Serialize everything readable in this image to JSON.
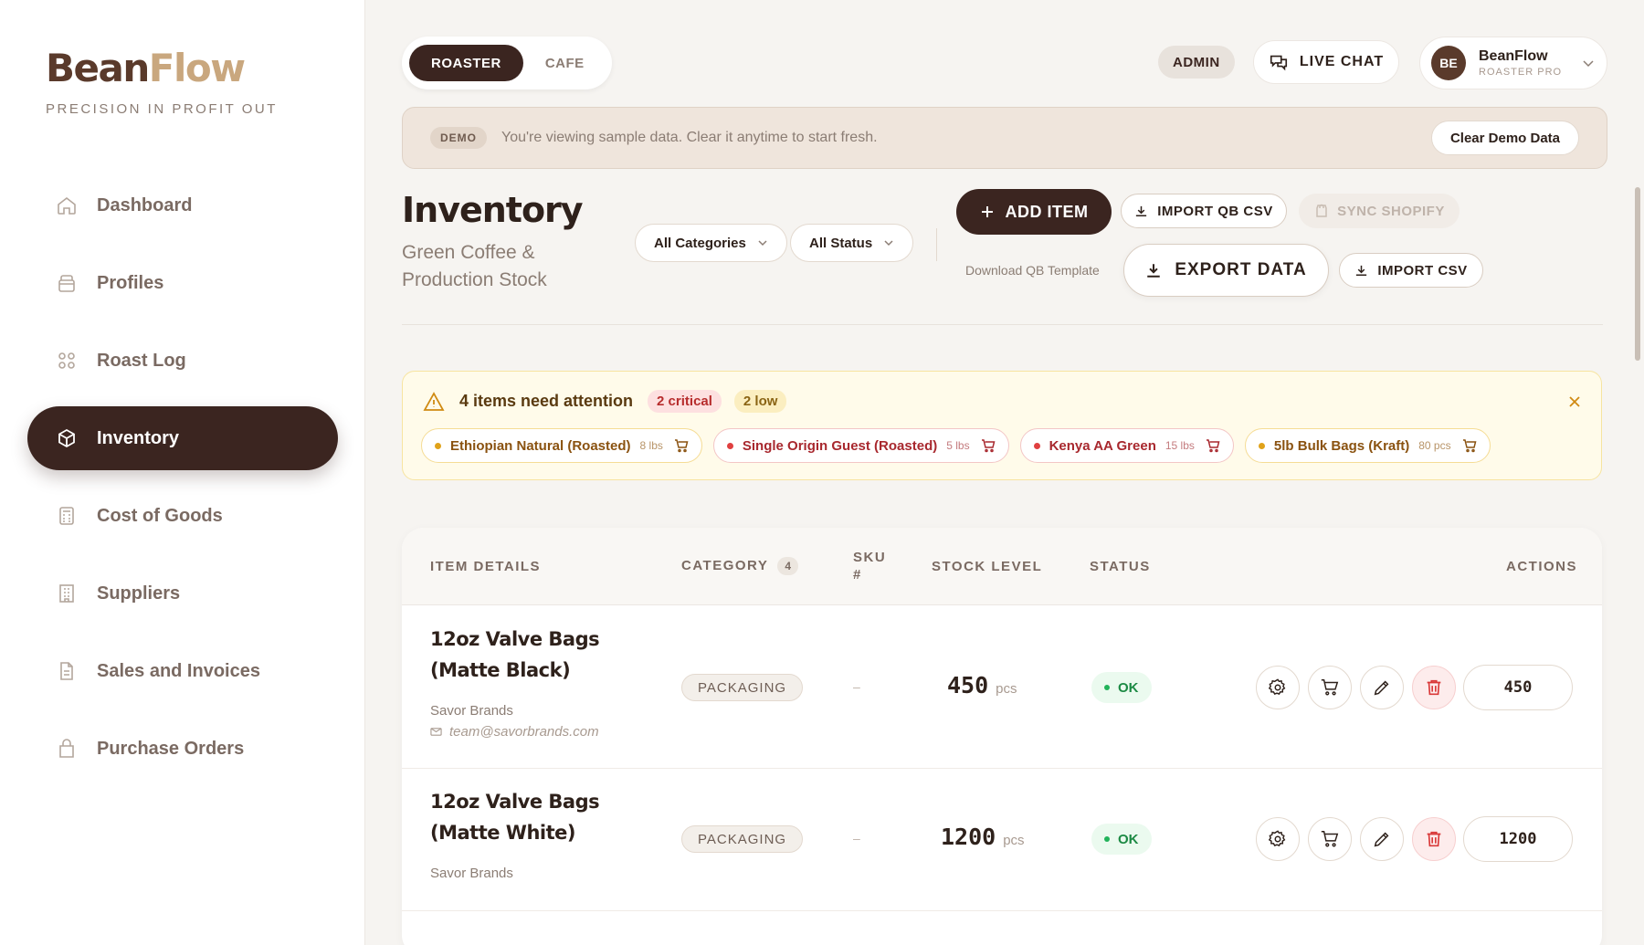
{
  "brand": {
    "name_part1": "Bean",
    "name_part2": "Flow",
    "tagline": "PRECISION IN PROFIT OUT"
  },
  "sidebar": {
    "items": [
      {
        "label": "Dashboard",
        "icon": "home-icon",
        "active": false
      },
      {
        "label": "Profiles",
        "icon": "box-icon",
        "active": false
      },
      {
        "label": "Roast Log",
        "icon": "grid-icon",
        "active": false
      },
      {
        "label": "Inventory",
        "icon": "cube-icon",
        "active": true
      },
      {
        "label": "Cost of Goods",
        "icon": "calculator-icon",
        "active": false
      },
      {
        "label": "Suppliers",
        "icon": "building-icon",
        "active": false
      },
      {
        "label": "Sales and Invoices",
        "icon": "document-icon",
        "active": false
      },
      {
        "label": "Purchase Orders",
        "icon": "bag-icon",
        "active": false
      }
    ]
  },
  "topbar": {
    "modes": [
      "ROASTER",
      "CAFE"
    ],
    "admin": "ADMIN",
    "live_chat": "LIVE CHAT",
    "user": {
      "initials": "BE",
      "name": "BeanFlow",
      "role": "ROASTER PRO"
    }
  },
  "demo": {
    "tag": "DEMO",
    "text": "You're viewing sample data. Clear it anytime to start fresh.",
    "clear_label": "Clear Demo Data"
  },
  "page": {
    "title": "Inventory",
    "subtitle": "Green Coffee & Production Stock",
    "filters": {
      "category": "All Categories",
      "status": "All Status"
    },
    "actions": {
      "add_item": "ADD ITEM",
      "import_qb": "IMPORT QB CSV",
      "sync_shopify": "SYNC SHOPIFY",
      "qb_template": "Download QB Template",
      "export": "EXPORT DATA",
      "import_csv": "IMPORT CSV"
    }
  },
  "alert": {
    "title": "4 items need attention",
    "critical": "2 critical",
    "low": "2 low",
    "items": [
      {
        "name": "Ethiopian Natural (Roasted)",
        "qty": "8 lbs",
        "level": "low"
      },
      {
        "name": "Single Origin Guest (Roasted)",
        "qty": "5 lbs",
        "level": "critical"
      },
      {
        "name": "Kenya AA Green",
        "qty": "15 lbs",
        "level": "critical"
      },
      {
        "name": "5lb Bulk Bags (Kraft)",
        "qty": "80 pcs",
        "level": "low"
      }
    ]
  },
  "table": {
    "headers": {
      "item": "ITEM DETAILS",
      "category": "CATEGORY",
      "category_count": "4",
      "sku": "SKU #",
      "stock": "STOCK LEVEL",
      "status": "STATUS",
      "actions": "ACTIONS"
    },
    "rows": [
      {
        "name": "12oz Valve Bags (Matte Black)",
        "vendor": "Savor Brands",
        "email": "team@savorbrands.com",
        "category": "PACKAGING",
        "sku": "–",
        "stock": "450",
        "unit": "pcs",
        "status": "OK",
        "qty": "450"
      },
      {
        "name": "12oz Valve Bags (Matte White)",
        "vendor": "Savor Brands",
        "email": "",
        "category": "PACKAGING",
        "sku": "–",
        "stock": "1200",
        "unit": "pcs",
        "status": "OK",
        "qty": "1200"
      }
    ]
  },
  "colors": {
    "brand_dark": "#3b2520",
    "brand_gold": "#c9a77e",
    "ok": "#1c8a44",
    "critical": "#e04040",
    "low": "#e0a21a"
  }
}
